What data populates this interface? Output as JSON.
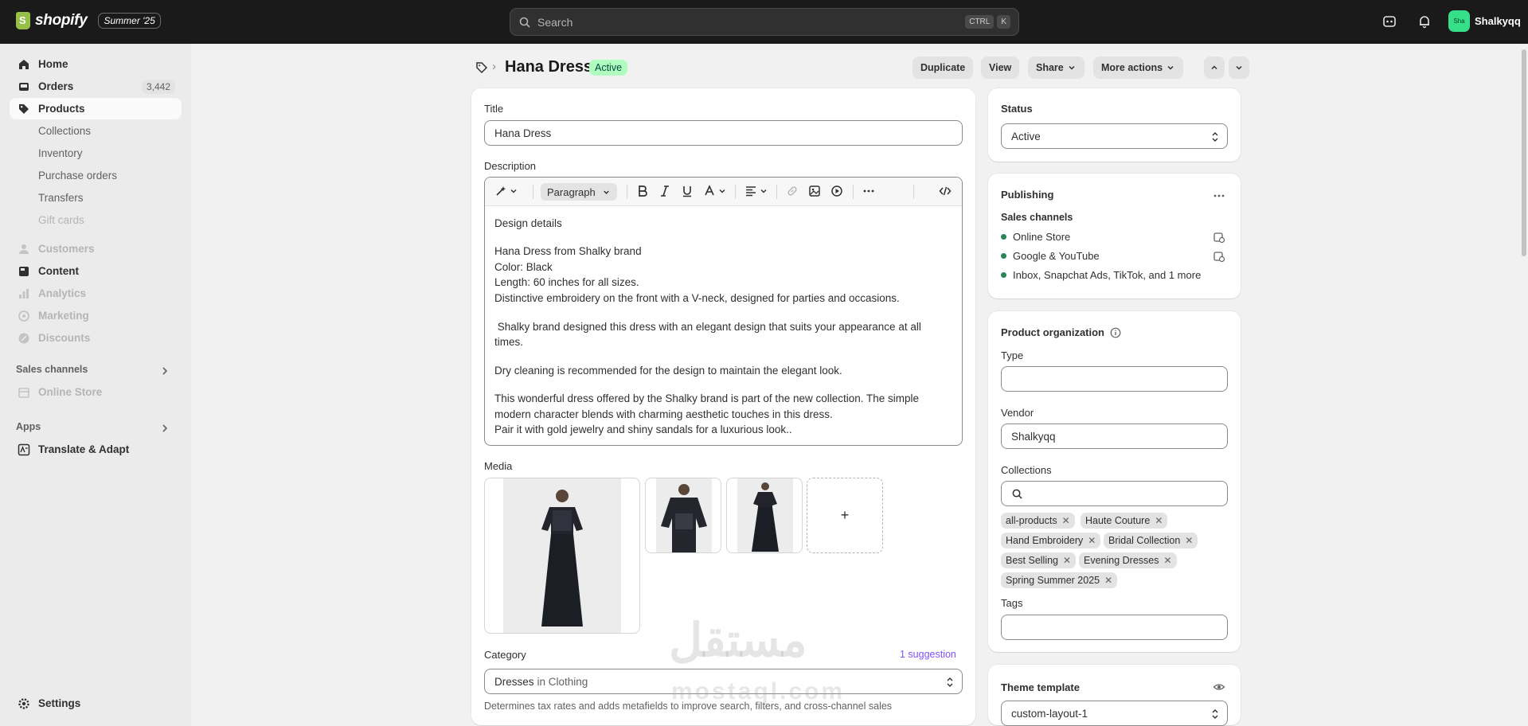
{
  "topbar": {
    "logo_text": "shopify",
    "edition": "Summer '25",
    "search_placeholder": "Search",
    "shortcut_ctrl": "CTRL",
    "shortcut_key": "K",
    "avatar_initials": "Sha",
    "store_name": "Shalkyqq"
  },
  "sidebar": {
    "home": "Home",
    "orders": "Orders",
    "orders_count": "3,442",
    "products": "Products",
    "collections": "Collections",
    "inventory": "Inventory",
    "purchase_orders": "Purchase orders",
    "transfers": "Transfers",
    "gift_cards": "Gift cards",
    "customers": "Customers",
    "content": "Content",
    "analytics": "Analytics",
    "marketing": "Marketing",
    "discounts": "Discounts",
    "sales_channels": "Sales channels",
    "online_store": "Online Store",
    "apps": "Apps",
    "translate": "Translate & Adapt",
    "settings": "Settings"
  },
  "header": {
    "crumb_sep": "›",
    "title": "Hana Dress",
    "status_badge": "Active",
    "duplicate": "Duplicate",
    "view": "View",
    "share": "Share",
    "more_actions": "More actions"
  },
  "main": {
    "title_label": "Title",
    "title_value": "Hana Dress",
    "description_label": "Description",
    "paragraph": "Paragraph",
    "description_lines": [
      "Design details",
      "Hana Dress from Shalky brand",
      "Color: Black",
      "Length: 60 inches for all sizes.",
      "Distinctive embroidery on the front with a V-neck, designed for parties and occasions.",
      " Shalky brand designed this dress with an elegant design that suits your appearance at all",
      "times.",
      "Dry cleaning is recommended for the design to maintain the elegant look.",
      "This wonderful dress offered by the Shalky brand is part of the new collection. The simple",
      "modern character blends with charming aesthetic touches in this dress.",
      "Pair it with gold jewelry and shiny sandals for a luxurious look.."
    ],
    "media_label": "Media",
    "add_media": "+",
    "category_label": "Category",
    "category_suggestion": "1 suggestion",
    "category_value": "Dresses",
    "category_in": "in Clothing",
    "category_help": "Determines tax rates and adds metafields to improve search, filters, and cross-channel sales"
  },
  "right": {
    "status_label": "Status",
    "status_value": "Active",
    "publishing_label": "Publishing",
    "sales_channels_label": "Sales channels",
    "channels": [
      "Online Store",
      "Google & YouTube",
      "Inbox, Snapchat Ads, TikTok, and 1 more"
    ],
    "org_label": "Product organization",
    "type_label": "Type",
    "type_value": "",
    "vendor_label": "Vendor",
    "vendor_value": "Shalkyqq",
    "collections_label": "Collections",
    "collections": [
      "all-products",
      "Haute Couture",
      "Hand Embroidery",
      "Bridal Collection",
      "Best Selling",
      "Evening Dresses",
      "Spring Summer 2025"
    ],
    "tags_label": "Tags",
    "theme_label": "Theme template",
    "theme_value": "custom-layout-1"
  },
  "watermark": {
    "arabic": "مستقل",
    "latin": "mostaql.com"
  },
  "colors": {
    "active_badge_bg": "#affebf",
    "channel_dot": "#29845a",
    "suggestion": "#8051ff"
  }
}
